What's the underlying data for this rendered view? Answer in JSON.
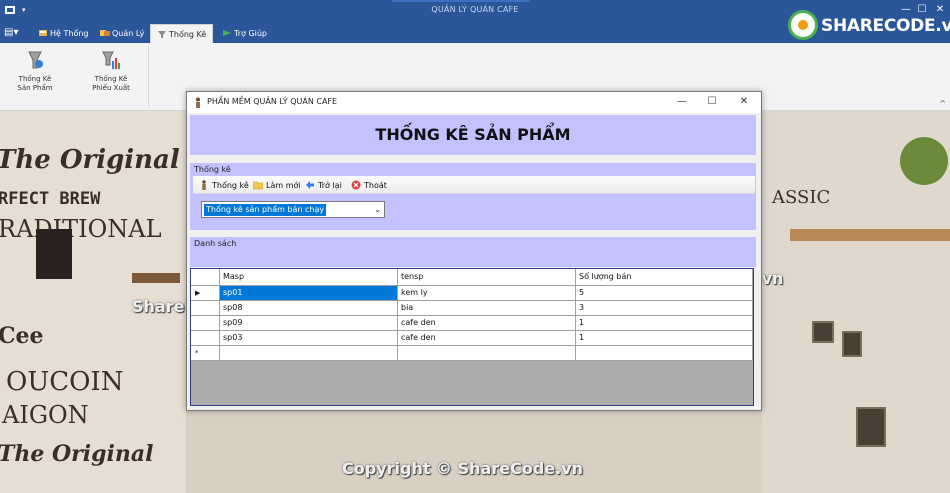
{
  "app": {
    "title": "QUẢN LÝ QUÁN CAFE",
    "quick_access_icon": "app-icon",
    "quick_access_dropdown": "▾",
    "app_menu_icon": "▤▾",
    "window_controls": [
      "—",
      "☐",
      "✕"
    ]
  },
  "ribbon": {
    "tabs": [
      {
        "label": "Hệ Thống",
        "icon": "system-icon"
      },
      {
        "label": "Quản Lý",
        "icon": "manage-icon"
      },
      {
        "label": "Thống Kê",
        "icon": "statistics-icon",
        "active": true
      },
      {
        "label": "Trợ Giúp",
        "icon": "help-icon"
      }
    ],
    "buttons": [
      {
        "label_line1": "Thống Kê",
        "label_line2": "Sản Phẩm",
        "icon": "product-stats-icon"
      },
      {
        "label_line1": "Thống Kê",
        "label_line2": "Phiếu Xuất",
        "icon": "export-slip-stats-icon"
      }
    ],
    "collapse_glyph": "^"
  },
  "logo": {
    "text": "SHARECODE.vn"
  },
  "background_text": {
    "the_original_top": "The Original",
    "perfect_brew": "RFECT BREW",
    "traditional": "RADITIONAL",
    "sharecode_left": "ShareCode.vn",
    "sharecode_right": "ShareCode.vn",
    "copyright": "Copyright © ShareCode.vn",
    "coffee": "Cee",
    "doucoin": "OUCOIN",
    "saigon": "AIGON",
    "the_original_bottom": "The Original",
    "classic": "ASSIC"
  },
  "dialog": {
    "title": "PHẦN MỀM QUẢN LÝ QUÁN CAFE",
    "controls": [
      "—",
      "☐",
      "✕"
    ],
    "header": "THỐNG KÊ SẢN PHẨM",
    "stats_group_label": "Thống kê",
    "toolbar": [
      {
        "label": "Thống kê",
        "icon": "statistics-icon"
      },
      {
        "label": "Làm mới",
        "icon": "refresh-folder-icon"
      },
      {
        "label": "Trở lại",
        "icon": "back-icon"
      },
      {
        "label": "Thoát",
        "icon": "exit-icon"
      }
    ],
    "combo_value": "Thống kê sản phẩm bán chạy",
    "combo_arrow": "⌄",
    "list_group_label": "Danh sách",
    "grid": {
      "columns": [
        "Masp",
        "tensp",
        "Số lượng bán"
      ],
      "rows": [
        [
          "sp01",
          "kem ly",
          "5"
        ],
        [
          "sp08",
          "bia",
          "3"
        ],
        [
          "sp09",
          "cafe den",
          "1"
        ],
        [
          "sp03",
          "cafe den",
          "1"
        ]
      ],
      "current_row_marker": "▶",
      "new_row_marker": "*"
    }
  }
}
